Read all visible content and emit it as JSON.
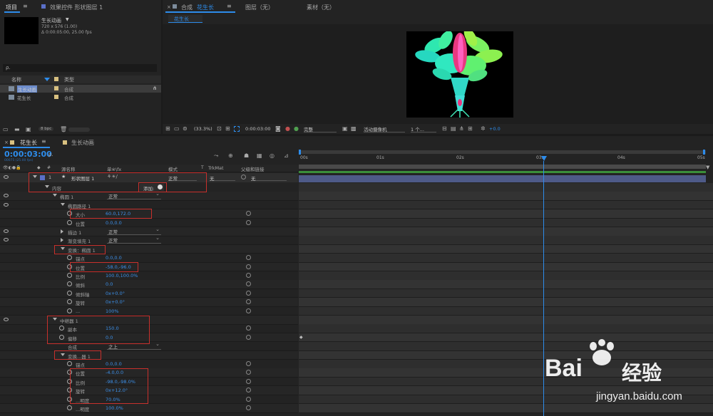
{
  "project_panel": {
    "tab_project": "项目",
    "tab_effects": "效果控件 形状图层 1",
    "comp_name": "生长动画",
    "comp_name_arrow": "▼",
    "comp_info1": "720 x 576 (1.00)",
    "comp_info2": "Δ 0:00:05:00, 25.00 fps",
    "search_placeholder": "ρ.",
    "col_name": "名称",
    "col_type": "类型",
    "items": [
      {
        "name": "生长动画",
        "type": "合成"
      },
      {
        "name": "花生长",
        "type": "合成"
      }
    ],
    "bpc": "8 bpc"
  },
  "comp_panel": {
    "tab_comp_prefix": "合成",
    "tab_comp_name": "花生长",
    "tab_layer": "图层（无）",
    "tab_footage": "素材（无）",
    "sub_tab": "花生长",
    "zoom": "(33.3%)",
    "timecode": "0:00:03:00",
    "resolution": "完整",
    "camera": "活动摄像机",
    "views": "1 个...",
    "exposure": "+0.0"
  },
  "timeline": {
    "tab_active": "花生长",
    "tab_other": "生长动画",
    "timecode": "0:00:03:00",
    "timecode_sub": "00075 (25.00 fps)",
    "search_placeholder": "ρ.",
    "col_num": "#",
    "col_source": "源名称",
    "col_switches": "单※\\fx",
    "col_mode": "模式",
    "col_t": "T",
    "col_trkmat": "TrkMat",
    "col_parent": "父级和链接",
    "ruler": [
      "00s",
      "01s",
      "02s",
      "03s",
      "04s",
      "05s"
    ],
    "layer": {
      "num": "1",
      "star": "★",
      "name": "形状图层 1",
      "mode": "正常",
      "trkmat": "无",
      "parent": "无"
    },
    "add_label": "添加:",
    "rows": [
      {
        "label": "内容",
        "value": "",
        "dd": ""
      },
      {
        "label": "椭圆 1",
        "value": "",
        "dd": "正常"
      },
      {
        "label": "椭圆路径 1",
        "value": "",
        "dd": ""
      },
      {
        "label": "大小",
        "value": "60.0,172.0",
        "dd": ""
      },
      {
        "label": "位置",
        "value": "0.0,0.0",
        "dd": ""
      },
      {
        "label": "描边 1",
        "value": "",
        "dd": "正常"
      },
      {
        "label": "渐变填充 1",
        "value": "",
        "dd": "正常"
      },
      {
        "label": "变换：椭圆 1",
        "value": "",
        "dd": ""
      },
      {
        "label": "锚点",
        "value": "0.0,0.0",
        "dd": ""
      },
      {
        "label": "位置",
        "value": "-58.0,-96.0",
        "dd": ""
      },
      {
        "label": "比例",
        "value": "100.0,100.0%",
        "dd": ""
      },
      {
        "label": "倾斜",
        "value": "0.0",
        "dd": ""
      },
      {
        "label": "倾斜轴",
        "value": "0x+0.0°",
        "dd": ""
      },
      {
        "label": "旋转",
        "value": "0x+0.0°",
        "dd": ""
      },
      {
        "label": "...",
        "value": "100%",
        "dd": ""
      },
      {
        "label": "中继器 1",
        "value": "",
        "dd": ""
      },
      {
        "label": "副本",
        "value": "150.0",
        "dd": ""
      },
      {
        "label": "偏移",
        "value": "0.0",
        "dd": ""
      },
      {
        "label": "合成",
        "value": "",
        "dd": "之上"
      },
      {
        "label": "变换...器 1",
        "value": "",
        "dd": ""
      },
      {
        "label": "锚点",
        "value": "0.0,0.0",
        "dd": ""
      },
      {
        "label": "位置",
        "value": "-4.0,0.0",
        "dd": ""
      },
      {
        "label": "比例",
        "value": "-98.0,-98.0%",
        "dd": ""
      },
      {
        "label": "旋转",
        "value": "0x+12.0°",
        "dd": ""
      },
      {
        "label": "...明度",
        "value": "70.0%",
        "dd": ""
      },
      {
        "label": "...明度",
        "value": "100.0%",
        "dd": ""
      }
    ]
  },
  "watermark": {
    "brand": "Bai",
    "brand2": "经验",
    "url": "jingyan.baidu.com"
  },
  "colors": {
    "accent": "#2d8ceb",
    "redbox": "#c8302c",
    "bg": "#232323"
  }
}
